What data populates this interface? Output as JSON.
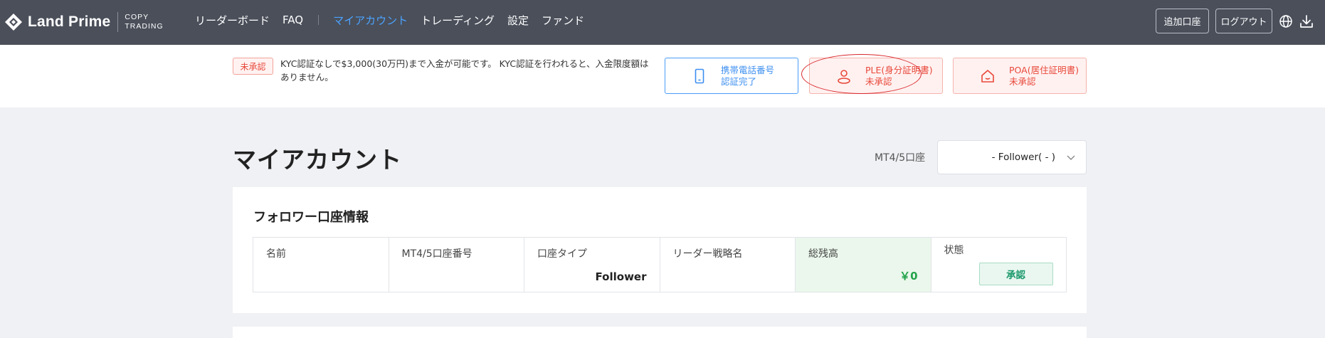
{
  "header": {
    "logo_text": "Land Prime",
    "logo_sub_1": "COPY",
    "logo_sub_2": "TRADING",
    "nav": [
      {
        "label": "リーダーボード"
      },
      {
        "label": "FAQ"
      },
      {
        "label": "マイアカウント"
      },
      {
        "label": "トレーディング"
      },
      {
        "label": "設定"
      },
      {
        "label": "ファンド"
      }
    ],
    "add_account": "追加口座",
    "logout": "ログアウト"
  },
  "kyc": {
    "badge": "未承認",
    "message": "KYC認証なしで$3,000(30万円)まで入金が可能です。 KYC認証を行われると、入金限度額はありません。",
    "cards": [
      {
        "line1": "携帯電話番号",
        "line2": "認証完了",
        "icon": "mobile-phone-icon"
      },
      {
        "line1": "PLE(身分証明書)",
        "line2": "未承認",
        "icon": "person-icon"
      },
      {
        "line1": "POA(居住証明書)",
        "line2": "未承認",
        "icon": "home-icon"
      }
    ]
  },
  "main": {
    "title": "マイアカウント",
    "account_label": "MT4/5口座",
    "account_value": "- Follower( - )"
  },
  "panel": {
    "title": "フォロワー口座情報",
    "columns": [
      {
        "head": "名前",
        "value": ""
      },
      {
        "head": "MT4/5口座番号",
        "value": ""
      },
      {
        "head": "口座タイプ",
        "value": "Follower"
      },
      {
        "head": "リーダー戦略名",
        "value": ""
      },
      {
        "head": "総残高",
        "value": "￥0"
      },
      {
        "head": "状態",
        "value": "承認"
      }
    ]
  },
  "colors": {
    "header_bg": "#4a4f5a",
    "nav_active": "#4aa3ff",
    "warning_red": "#e8483a",
    "verified_blue": "#3d8ff0",
    "balance_green": "#22a34a"
  }
}
